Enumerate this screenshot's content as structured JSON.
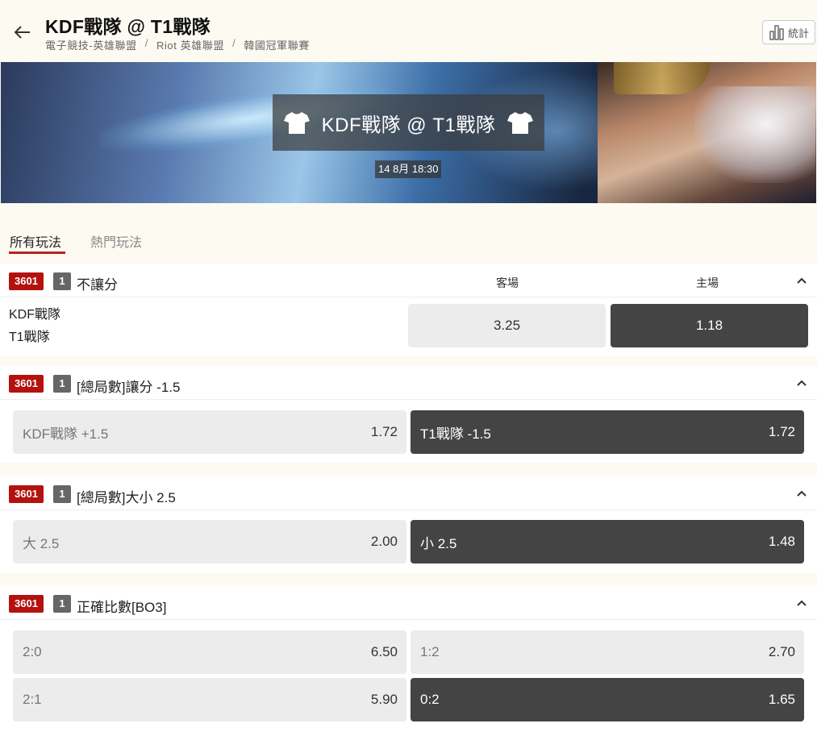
{
  "header": {
    "title": "KDF戰隊 @ T1戰隊",
    "breadcrumbs": [
      "電子競技-英雄聯盟",
      "Riot 英雄聯盟",
      "韓國冠軍聯賽"
    ],
    "separator": "/",
    "stats_label": "統計"
  },
  "banner": {
    "match_title": "KDF戰隊 @ T1戰隊",
    "time": "14 8月 18:30"
  },
  "tabs": {
    "all": "所有玩法",
    "popular": "熱門玩法"
  },
  "markets": {
    "moneyline": {
      "id": "3601",
      "num": "1",
      "name": "不讓分",
      "away_header": "客場",
      "home_header": "主場",
      "team1": "KDF戰隊",
      "team2": "T1戰隊",
      "away_odds": "3.25",
      "home_odds": "1.18"
    },
    "handicap": {
      "id": "3601",
      "num": "1",
      "name": "[總局數]讓分 -1.5",
      "left_label": "KDF戰隊 +1.5",
      "left_odds": "1.72",
      "right_label": "T1戰隊 -1.5",
      "right_odds": "1.72"
    },
    "totals": {
      "id": "3601",
      "num": "1",
      "name": "[總局數]大小 2.5",
      "left_label": "大 2.5",
      "left_odds": "2.00",
      "right_label": "小 2.5",
      "right_odds": "1.48"
    },
    "correct_score": {
      "id": "3601",
      "num": "1",
      "name": "正確比數[BO3]",
      "options": [
        {
          "label": "2:0",
          "odds": "6.50"
        },
        {
          "label": "1:2",
          "odds": "2.70"
        },
        {
          "label": "2:1",
          "odds": "5.90"
        },
        {
          "label": "0:2",
          "odds": "1.65"
        }
      ]
    }
  },
  "colors": {
    "accent_red": "#b3120e",
    "dark_button": "#444444",
    "light_button": "#ececec",
    "page_bg": "#fdfaf2"
  }
}
